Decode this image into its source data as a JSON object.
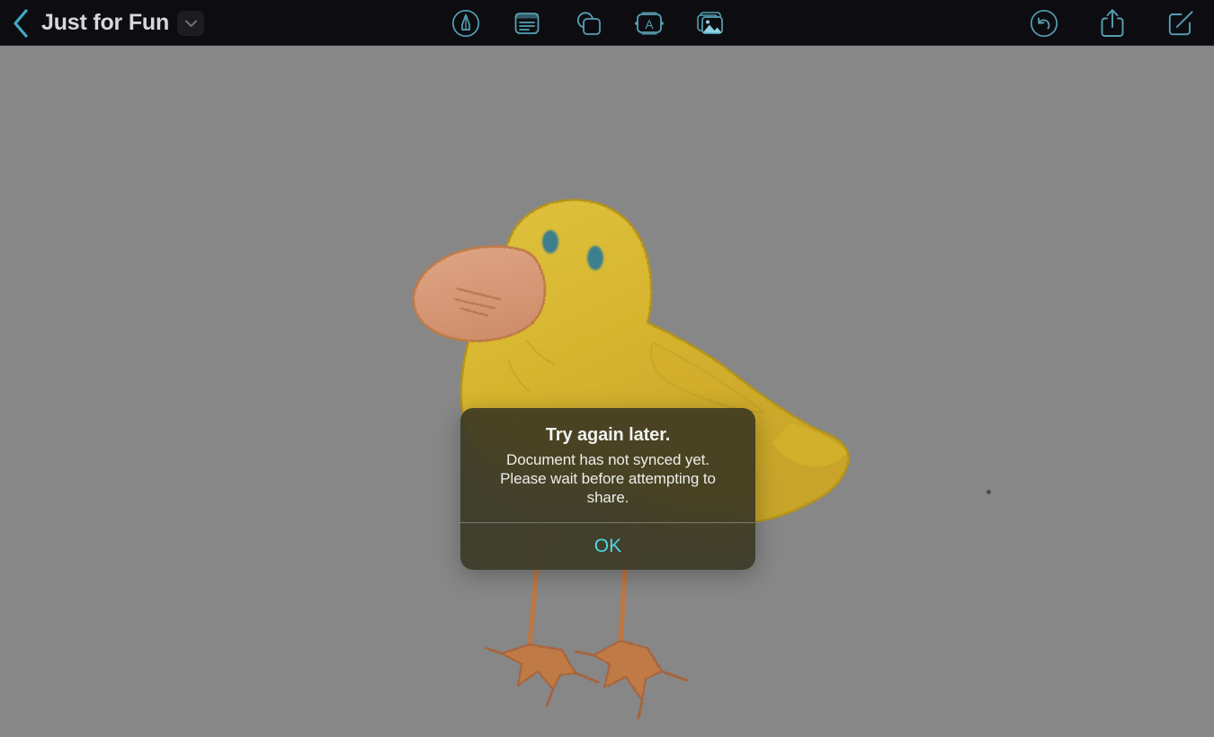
{
  "toolbar": {
    "back_label": "Back",
    "document_title": "Just for Fun",
    "title_menu_label": "Document options",
    "center_tools": [
      {
        "name": "markup-tool",
        "label": "Markup"
      },
      {
        "name": "format-tool",
        "label": "Format"
      },
      {
        "name": "shapes-tool",
        "label": "Shapes"
      },
      {
        "name": "text-box-tool",
        "label": "Text Box"
      },
      {
        "name": "media-tool",
        "label": "Media"
      }
    ],
    "right_tools": [
      {
        "name": "undo",
        "label": "Undo"
      },
      {
        "name": "share",
        "label": "Share"
      },
      {
        "name": "compose",
        "label": "Compose"
      }
    ],
    "colors": {
      "background": "#0d0d11",
      "title_text": "#d8d8da",
      "icon_tint": "#56a0b4",
      "back_chevron": "#3fa9c4"
    }
  },
  "canvas": {
    "background_color": "#878787",
    "artwork": {
      "name": "hand-drawn-duck",
      "description": "Hand-painted yellow duck with orange beak, teal eyes and orange webbed feet",
      "body_color": "#d9b730",
      "beak_color": "#d89a79",
      "eye_color": "#3c7f8d",
      "foot_color": "#c07a45"
    }
  },
  "alert": {
    "title": "Try again later.",
    "message": "Document has not synced yet. Please wait before attempting to share.",
    "button_label": "OK",
    "button_color": "#4fd8df",
    "background_color": "#3a3724"
  }
}
